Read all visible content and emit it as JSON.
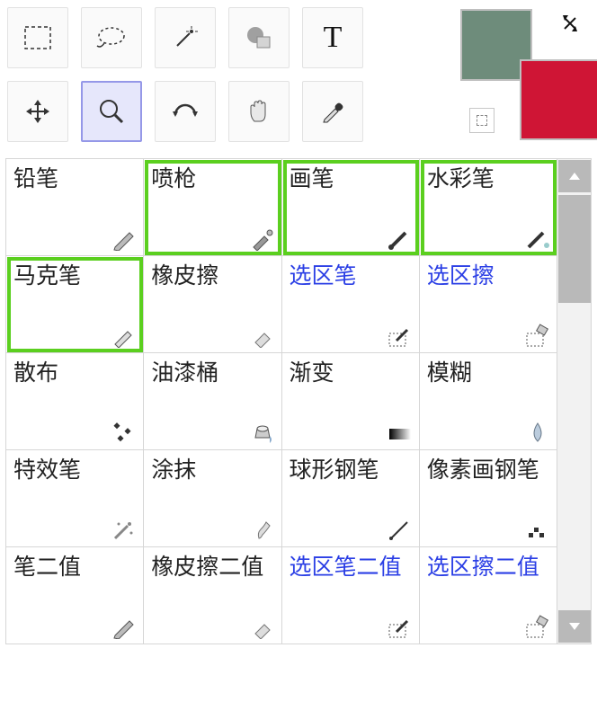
{
  "toolbar": {
    "tools": [
      {
        "name": "rect-select",
        "selected": false
      },
      {
        "name": "lasso",
        "selected": false
      },
      {
        "name": "magic-wand",
        "selected": false
      },
      {
        "name": "shape",
        "selected": false
      },
      {
        "name": "text",
        "selected": false
      },
      {
        "name": "",
        "hidden_slot": true
      },
      {
        "name": "move",
        "selected": false
      },
      {
        "name": "zoom",
        "selected": true
      },
      {
        "name": "rotate",
        "selected": false
      },
      {
        "name": "hand",
        "selected": false
      },
      {
        "name": "eyedropper",
        "selected": false
      },
      {
        "name": "",
        "hidden_slot": true
      }
    ],
    "colors": {
      "foreground": "#6e8c7b",
      "background": "#cf1535"
    }
  },
  "brushes": [
    {
      "label": "铅笔",
      "icon": "pencil",
      "highlight": false,
      "blue": false
    },
    {
      "label": "喷枪",
      "icon": "airbrush",
      "highlight": true,
      "blue": false
    },
    {
      "label": "画笔",
      "icon": "brush",
      "highlight": true,
      "blue": false
    },
    {
      "label": "水彩笔",
      "icon": "watercolor",
      "highlight": true,
      "blue": false
    },
    {
      "label": "马克笔",
      "icon": "marker",
      "highlight": true,
      "blue": false
    },
    {
      "label": "橡皮擦",
      "icon": "eraser",
      "highlight": false,
      "blue": false
    },
    {
      "label": "选区笔",
      "icon": "sel-pen",
      "highlight": false,
      "blue": true
    },
    {
      "label": "选区擦",
      "icon": "sel-eraser",
      "highlight": false,
      "blue": true
    },
    {
      "label": "散布",
      "icon": "scatter",
      "highlight": false,
      "blue": false
    },
    {
      "label": "油漆桶",
      "icon": "bucket",
      "highlight": false,
      "blue": false
    },
    {
      "label": "渐变",
      "icon": "gradient",
      "highlight": false,
      "blue": false
    },
    {
      "label": "模糊",
      "icon": "blur",
      "highlight": false,
      "blue": false
    },
    {
      "label": "特效笔",
      "icon": "fx",
      "highlight": false,
      "blue": false
    },
    {
      "label": "涂抹",
      "icon": "smudge",
      "highlight": false,
      "blue": false
    },
    {
      "label": "球形钢笔",
      "icon": "ballpen",
      "highlight": false,
      "blue": false
    },
    {
      "label": "像素画钢笔",
      "icon": "pixel",
      "highlight": false,
      "blue": false
    },
    {
      "label": "笔二值",
      "icon": "pencil",
      "highlight": false,
      "blue": false
    },
    {
      "label": "橡皮擦二值",
      "icon": "eraser",
      "highlight": false,
      "blue": false
    },
    {
      "label": "选区笔二值",
      "icon": "sel-pen",
      "highlight": false,
      "blue": true
    },
    {
      "label": "选区擦二值",
      "icon": "sel-eraser",
      "highlight": false,
      "blue": true
    }
  ]
}
